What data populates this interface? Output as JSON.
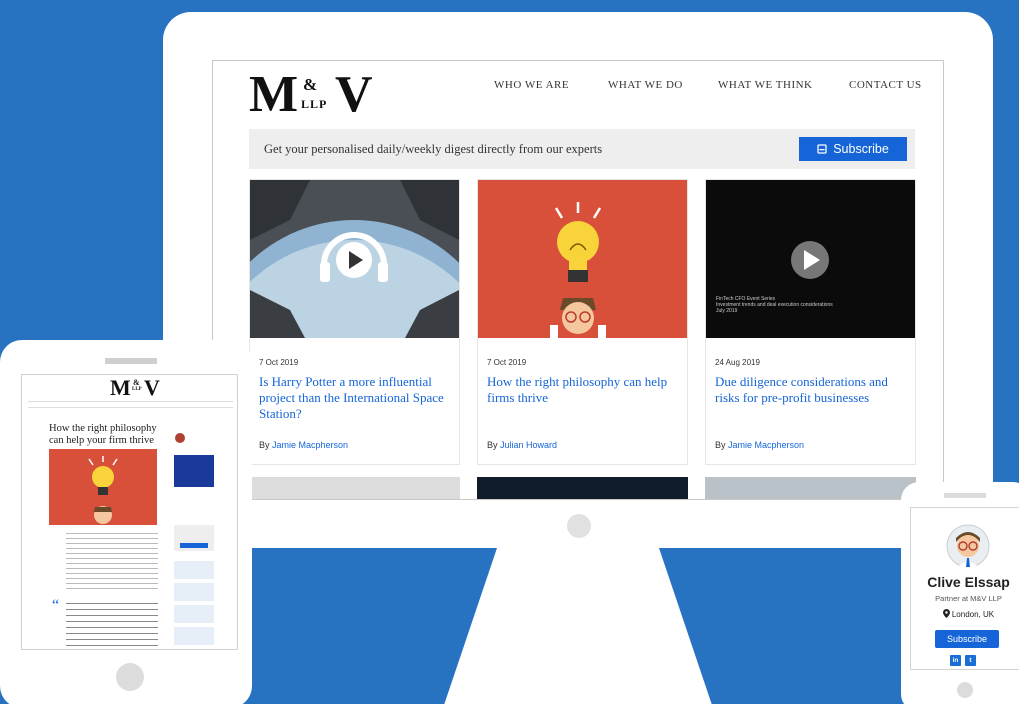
{
  "brand": {
    "logo_m": "M",
    "logo_amp": "&",
    "logo_llp": "LLP",
    "logo_v": "V"
  },
  "nav": [
    "WHO WE ARE",
    "WHAT WE DO",
    "WHAT WE THINK",
    "CONTACT US"
  ],
  "digest": {
    "text": "Get your personalised daily/weekly digest directly from our experts",
    "button": "Subscribe"
  },
  "cards": [
    {
      "date": "7 Oct 2019",
      "title": "Is Harry Potter a more influential project than the International Space Station?",
      "by": "By ",
      "author": "Jamie Macpherson"
    },
    {
      "date": "7 Oct 2019",
      "title": "How the right philosophy can help firms thrive",
      "by": "By ",
      "author": "Julian Howard"
    },
    {
      "date": "24 Aug 2019",
      "title": "Due diligence considerations and risks for pre-profit businesses",
      "by": "By ",
      "author": "Jamie Macpherson",
      "video_caption": "FinTech CFO Event Series",
      "video_sub": "Investment trends and deal execution considerations",
      "video_date": "July 2019"
    }
  ],
  "tablet": {
    "title": "How the right philosophy can help your firm thrive"
  },
  "phone": {
    "name": "Clive Elssap",
    "role": "Partner at M&V LLP",
    "location": "London, UK",
    "button": "Subscribe",
    "social": [
      "in",
      "t"
    ]
  },
  "colors": {
    "background": "#2872c2",
    "accent": "#1565d8",
    "card2_bg": "#d8503a"
  },
  "icons": [
    "headphone-play-icon",
    "lightbulb-icon",
    "play-icon",
    "subscribe-icon",
    "location-pin-icon",
    "linkedin-icon",
    "twitter-icon"
  ]
}
